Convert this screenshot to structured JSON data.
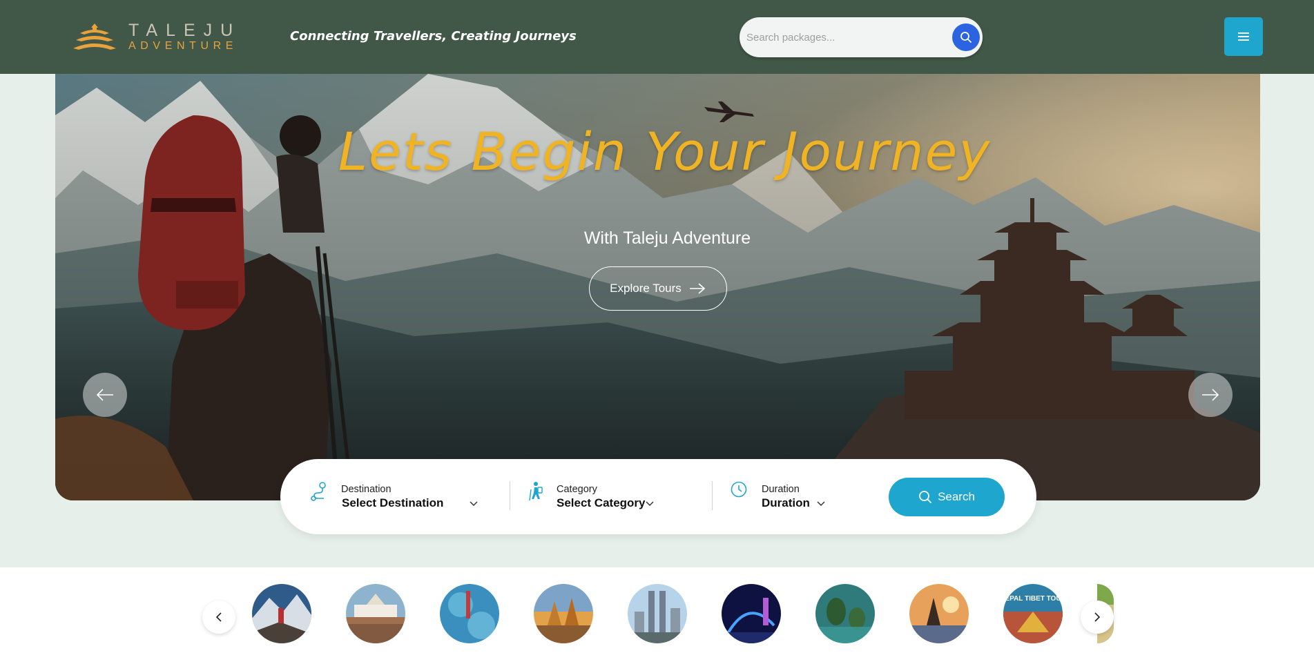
{
  "header": {
    "logo_top": "TALEJU",
    "logo_bottom": "ADVENTURE",
    "tagline": "Connecting Travellers, Creating Journeys",
    "search_placeholder": "Search packages...",
    "search_icon": "search-icon",
    "menu_icon": "hamburger-menu-icon"
  },
  "hero": {
    "title": "Lets Begin Your Journey",
    "subtitle": "With Taleju Adventure",
    "cta_label": "Explore Tours",
    "prev_icon": "arrow-left-icon",
    "next_icon": "arrow-right-icon"
  },
  "filters": {
    "destination": {
      "label": "Destination",
      "value": "Select Destination"
    },
    "category": {
      "label": "Category",
      "value": "Select Category"
    },
    "duration": {
      "label": "Duration",
      "value": "Duration"
    },
    "search_label": "Search"
  },
  "destinations_strip": {
    "items": [
      {
        "name": "mountain-climber"
      },
      {
        "name": "lake-temple"
      },
      {
        "name": "climbing"
      },
      {
        "name": "temple-sunset"
      },
      {
        "name": "city-towers"
      },
      {
        "name": "night-city"
      },
      {
        "name": "island-bay"
      },
      {
        "name": "water-temple"
      },
      {
        "name": "nepal-tibet-tour",
        "label": "NEPAL TIBET TOUR"
      },
      {
        "name": "green-landscape"
      }
    ]
  },
  "colors": {
    "header_bg": "#415848",
    "page_bg": "#e6efea",
    "accent": "#1ea6cf",
    "title_gold": "#f0b323",
    "search_blue": "#2b63e0"
  }
}
